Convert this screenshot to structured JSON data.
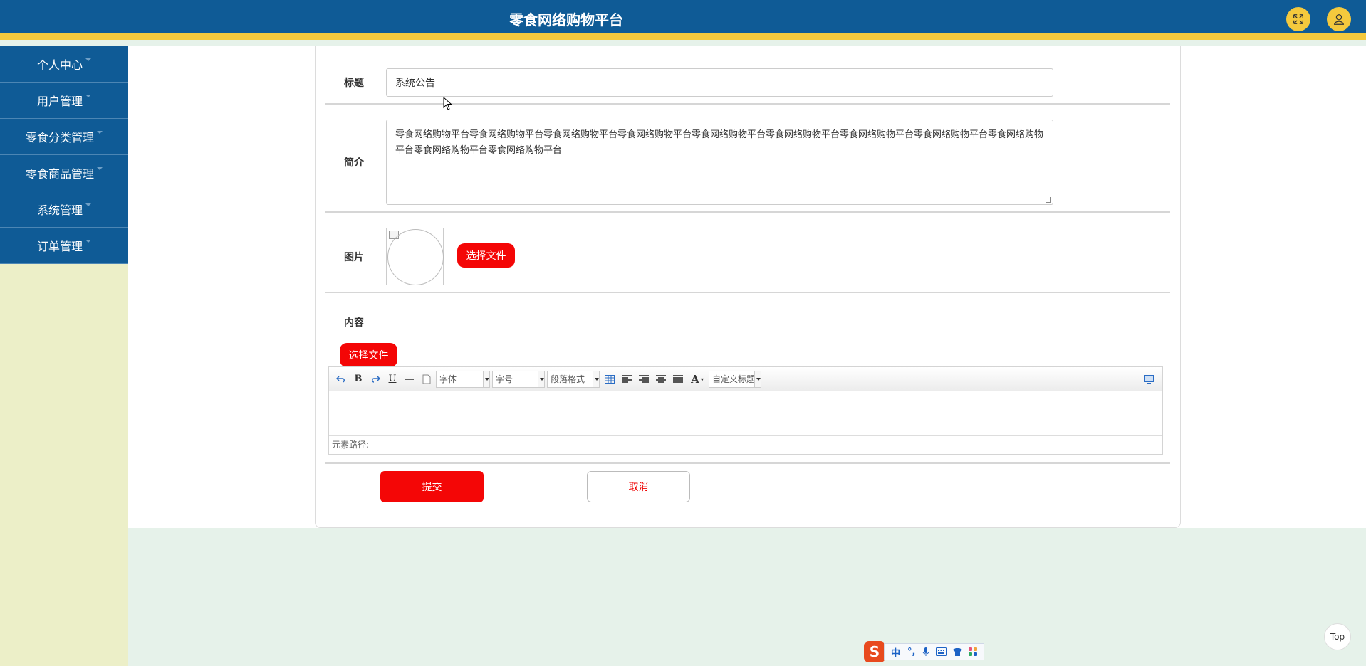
{
  "header": {
    "title": "零食网络购物平台",
    "fullscreen_icon": "expand-icon",
    "user_icon": "user-icon"
  },
  "sidebar": {
    "items": [
      {
        "label": "个人中心"
      },
      {
        "label": "用户管理"
      },
      {
        "label": "零食分类管理"
      },
      {
        "label": "零食商品管理"
      },
      {
        "label": "系统管理"
      },
      {
        "label": "订单管理"
      }
    ]
  },
  "form": {
    "title_label": "标题",
    "title_value": "系统公告",
    "intro_label": "简介",
    "intro_value": "零食网络购物平台零食网络购物平台零食网络购物平台零食网络购物平台零食网络购物平台零食网络购物平台零食网络购物平台零食网络购物平台零食网络购物平台零食网络购物平台零食网络购物平台",
    "image_label": "图片",
    "choose_file_label": "选择文件",
    "content_label": "内容",
    "content_choose_file_label": "选择文件",
    "submit_label": "提交",
    "cancel_label": "取消"
  },
  "editor": {
    "font_select": "字体",
    "size_select": "字号",
    "paragraph_select": "段落格式",
    "custom_title_select": "自定义标题",
    "path_label": "元素路径:"
  },
  "top_button": "Top",
  "ime": {
    "logo": "S",
    "mode": "中",
    "punct": "°,"
  }
}
